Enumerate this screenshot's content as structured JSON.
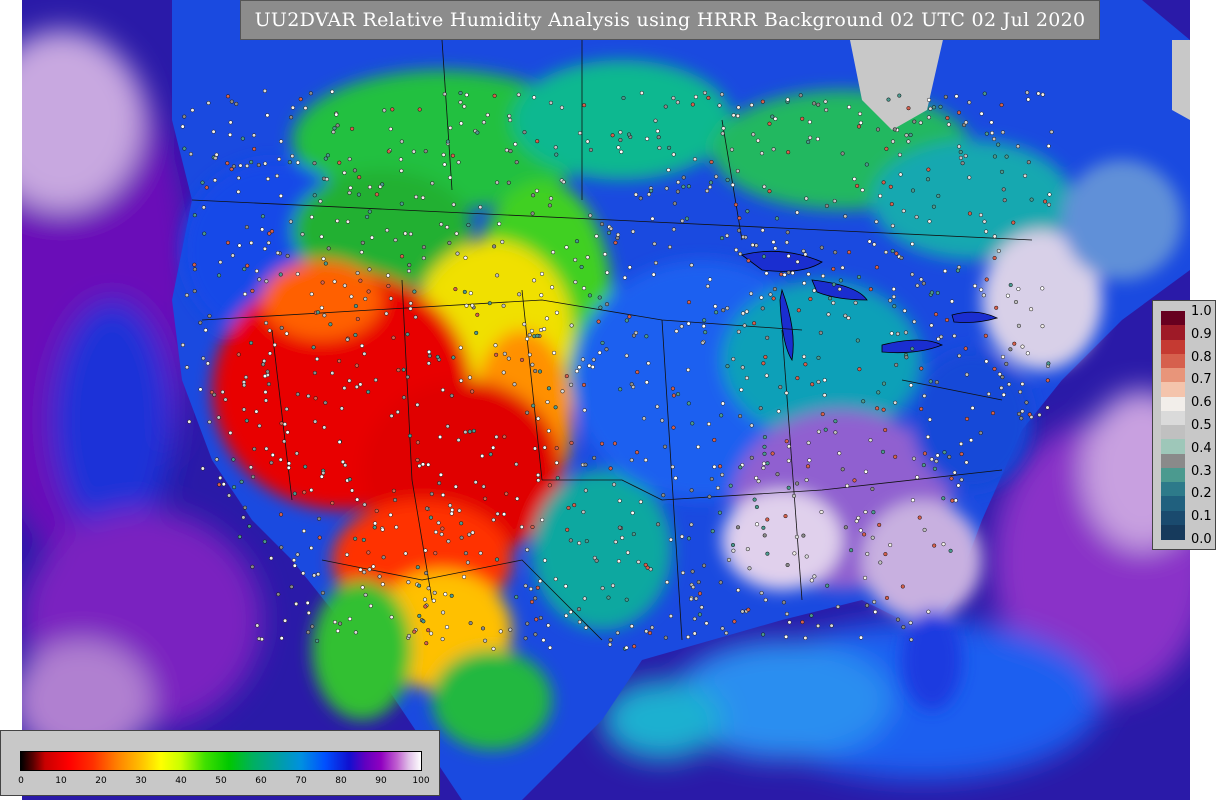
{
  "title": "UU2DVAR Relative Humidity Analysis using HRRR Background 02 UTC 02 Jul 2020",
  "error_legend": {
    "ticks": [
      "1.0",
      "0.9",
      "0.8",
      "0.7",
      "0.6",
      "0.5",
      "0.4",
      "0.3",
      "0.2",
      "0.1",
      "0.0"
    ],
    "colors": [
      "#67001f",
      "#9e1a27",
      "#c53a32",
      "#d6604d",
      "#e8957a",
      "#f4c4ac",
      "#f2eeea",
      "#dadada",
      "#c0c0c0",
      "#9ec7b9",
      "#8a8a8a",
      "#4b9a8f",
      "#2d7a8a",
      "#20607e",
      "#1a4a6e",
      "#163a5c"
    ]
  },
  "rh_legend": {
    "ticks": [
      "0",
      "10",
      "20",
      "30",
      "40",
      "50",
      "60",
      "70",
      "80",
      "90",
      "100"
    ]
  },
  "colors": {
    "very_dry": "#e00000",
    "dry": "#ff8c00",
    "moderate": "#ffe800",
    "moist": "#20c020",
    "humid": "#00a8c0",
    "very_humid": "#1848e8",
    "saturated": "#6a10b8",
    "ocean": "#2a1aa8",
    "masked": "#c8c8c8"
  }
}
